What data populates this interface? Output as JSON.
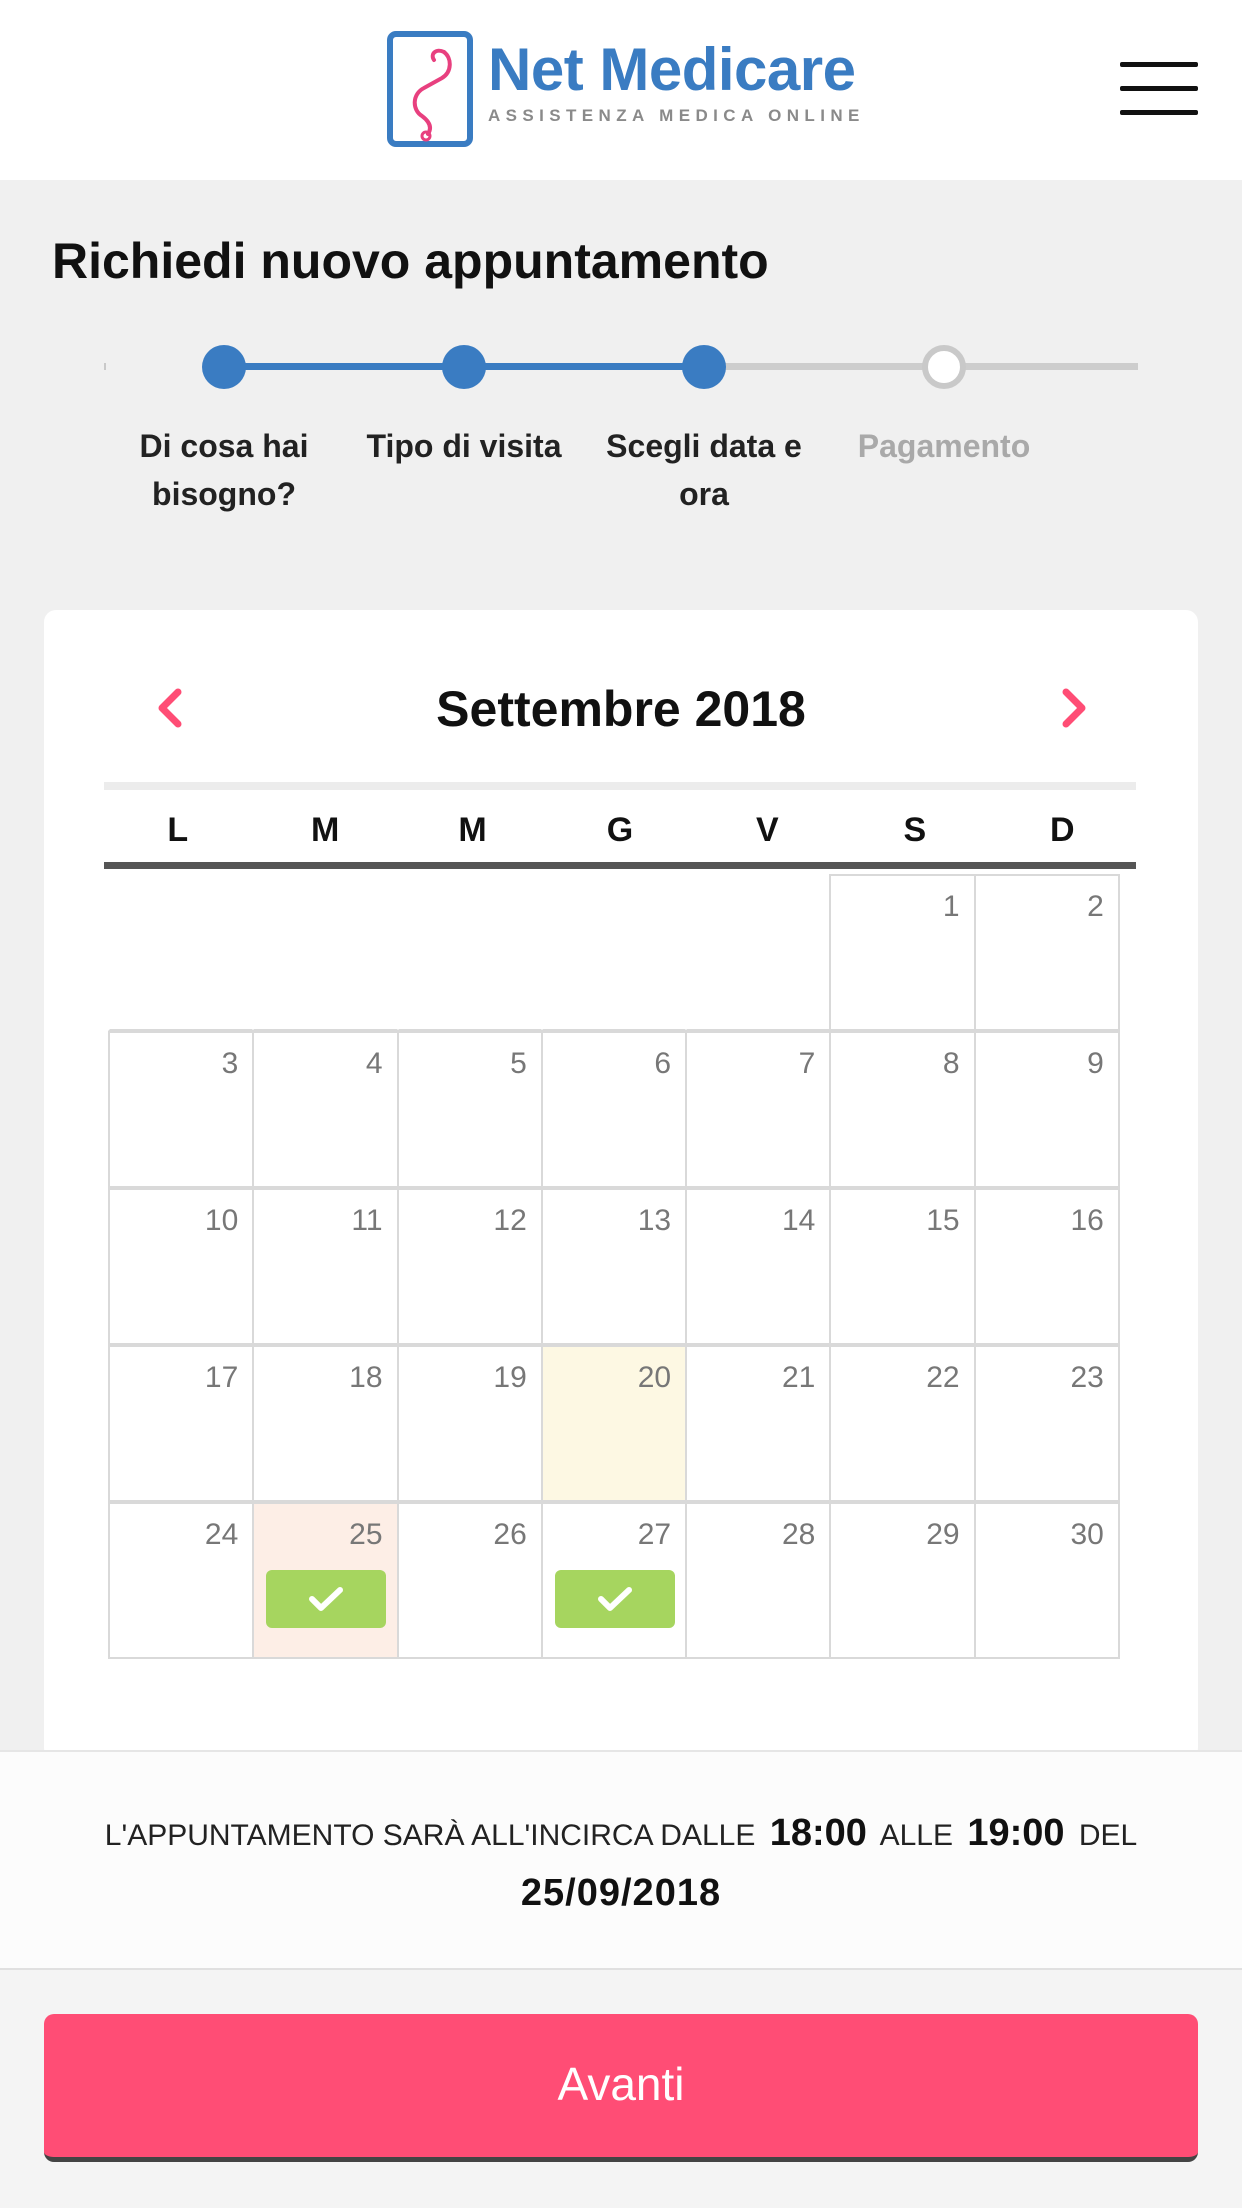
{
  "header": {
    "logo_title": "Net Medicare",
    "logo_subtitle": "ASSISTENZA MEDICA ONLINE",
    "menu_icon": "hamburger-menu-icon"
  },
  "page": {
    "title": "Richiedi nuovo appuntamento"
  },
  "stepper": {
    "steps": [
      {
        "label": "Di cosa hai bisogno?",
        "state": "done"
      },
      {
        "label": "Tipo di visita",
        "state": "done"
      },
      {
        "label": "Scegli data e ora",
        "state": "current"
      },
      {
        "label": "Pagamento",
        "state": "todo"
      }
    ]
  },
  "calendar": {
    "month_label": "Settembre 2018",
    "prev_icon": "chevron-left-icon",
    "next_icon": "chevron-right-icon",
    "weekdays": [
      "L",
      "M",
      "M",
      "G",
      "V",
      "S",
      "D"
    ],
    "weeks": [
      [
        null,
        null,
        null,
        null,
        null,
        "1",
        "2"
      ],
      [
        "3",
        "4",
        "5",
        "6",
        "7",
        "8",
        "9"
      ],
      [
        "10",
        "11",
        "12",
        "13",
        "14",
        "15",
        "16"
      ],
      [
        "17",
        "18",
        "19",
        "20",
        "21",
        "22",
        "23"
      ],
      [
        "24",
        "25",
        "26",
        "27",
        "28",
        "29",
        "30"
      ]
    ],
    "today": "20",
    "selected": "25",
    "available_days": [
      "25",
      "27"
    ],
    "available_icon": "checkmark-icon"
  },
  "appointment_info": {
    "prefix": "L'APPUNTAMENTO SARÀ ALL'INCIRCA DALLE",
    "start_time": "18:00",
    "middle": "ALLE",
    "end_time": "19:00",
    "suffix": "DEL",
    "date": "25/09/2018"
  },
  "actions": {
    "next_label": "Avanti"
  },
  "colors": {
    "brand_blue": "#3a7cc2",
    "accent_pink": "#ff4d75",
    "available_green": "#a6d55f",
    "today_bg": "#fdf8e3",
    "selected_bg": "#fdeee6"
  }
}
